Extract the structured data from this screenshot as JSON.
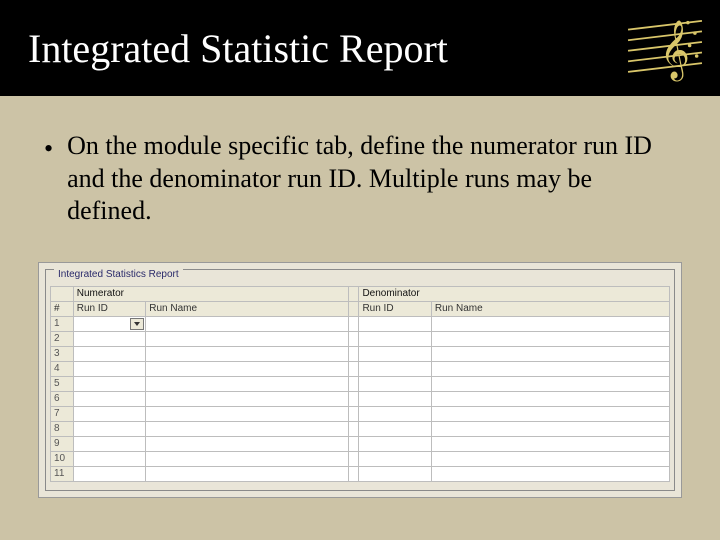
{
  "title": "Integrated Statistic Report",
  "bullet": "On the module specific tab, define the numerator run ID and the denominator run ID. Multiple runs may be defined.",
  "panel": {
    "legend": "Integrated Statistics Report",
    "sections": {
      "numerator": "Numerator",
      "denominator": "Denominator"
    },
    "columns": {
      "rownum": "#",
      "runid": "Run ID",
      "runname": "Run Name"
    },
    "row_numbers": [
      "1",
      "2",
      "3",
      "4",
      "5",
      "6",
      "7",
      "8",
      "9",
      "10",
      "11"
    ]
  }
}
